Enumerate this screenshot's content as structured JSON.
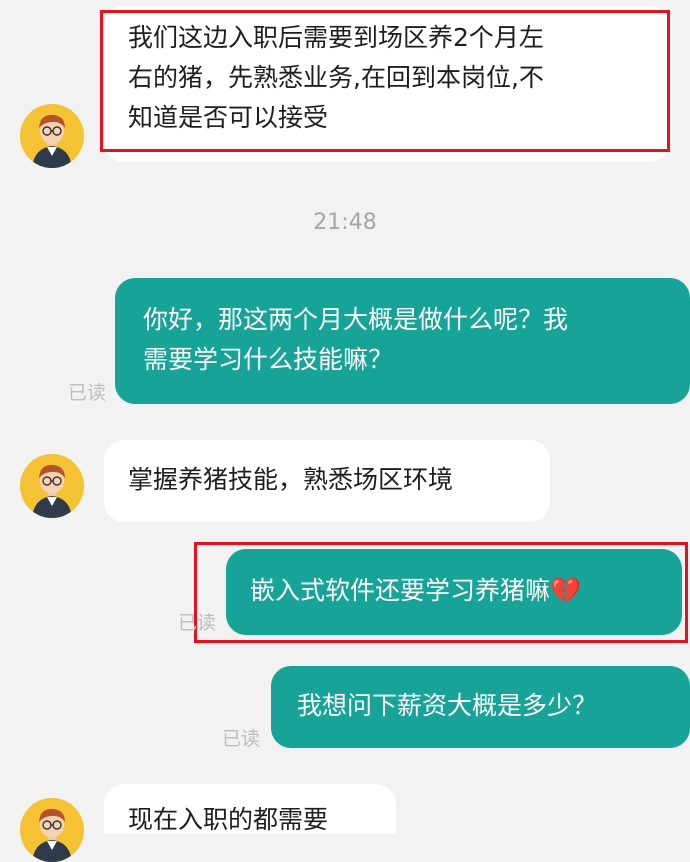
{
  "messages": [
    {
      "lines": [
        "我们这边入职后需要到场区养2个月左",
        "右的猪，先熟悉业务,在回到本岗位,不",
        "知道是否可以接受"
      ]
    },
    {
      "time": "21:48"
    },
    {
      "lines": [
        "你好，那这两个月大概是做什么呢？我",
        "需要学习什么技能嘛？"
      ],
      "status": "已读"
    },
    {
      "lines": [
        "掌握养猪技能，熟悉场区环境"
      ]
    },
    {
      "text": "嵌入式软件还要学习养猪嘛",
      "emoji": "💔",
      "status": "已读"
    },
    {
      "text": "我想问下薪资大概是多少？",
      "status": "已读"
    },
    {
      "text": "现在入职的都需要"
    }
  ],
  "colors": {
    "outgoing_bubble": "#17a398",
    "incoming_bubble": "#ffffff",
    "highlight_border": "#e0141e",
    "avatar_bg": "#f4c233"
  }
}
